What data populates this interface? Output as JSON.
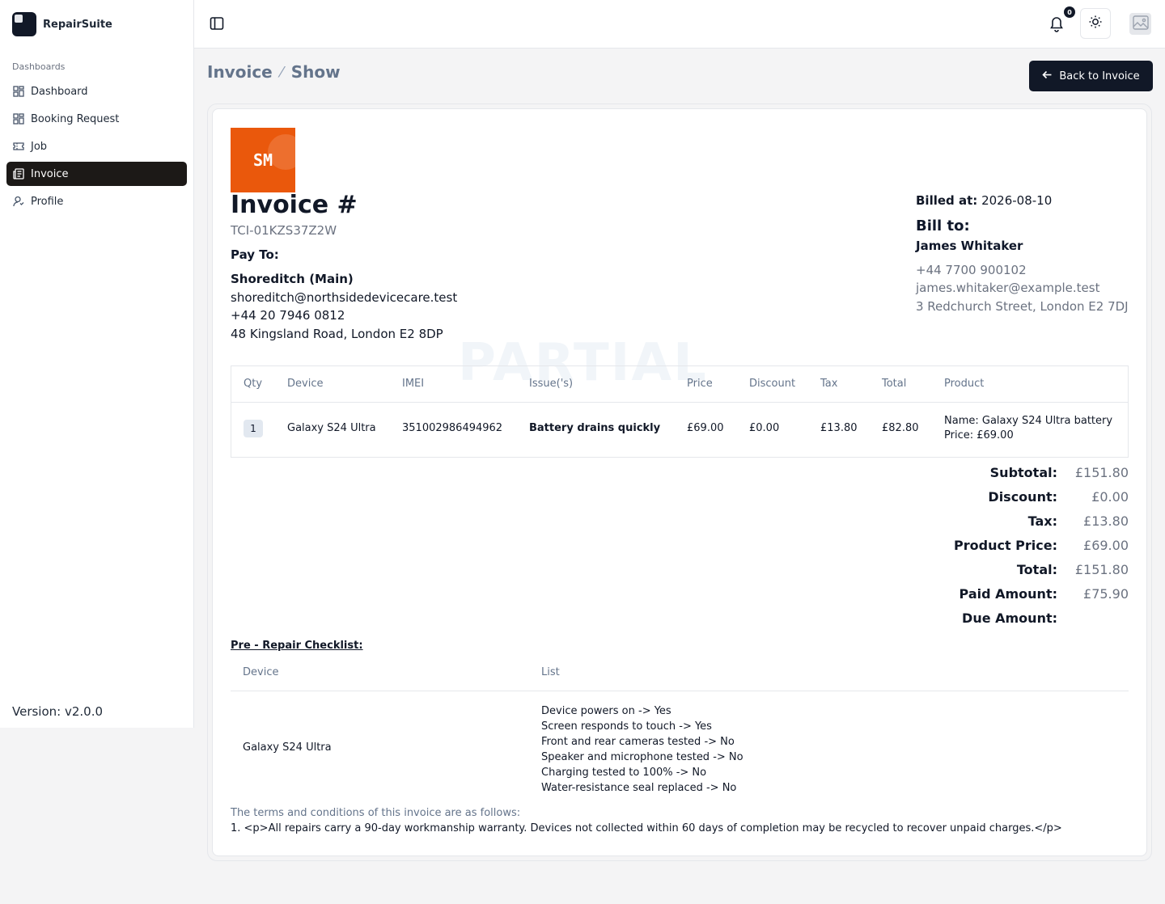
{
  "app": {
    "name": "RepairSuite",
    "version": "Version: v2.0.0"
  },
  "sidebar": {
    "group": "Dashboards",
    "items": [
      {
        "label": "Dashboard",
        "icon": "grid-icon"
      },
      {
        "label": "Booking Request",
        "icon": "grid-icon"
      },
      {
        "label": "Job",
        "icon": "ticket-icon"
      },
      {
        "label": "Invoice",
        "icon": "document-icon",
        "active": true
      },
      {
        "label": "Profile",
        "icon": "user-icon"
      }
    ]
  },
  "topbar": {
    "notification_count": "0"
  },
  "header": {
    "breadcrumb": [
      "Invoice",
      "Show"
    ],
    "back_button": "Back to Invoice"
  },
  "invoice": {
    "logo_text": "SM",
    "title": "Invoice #",
    "number": "TCI-01KZS37Z2W",
    "watermark": "PARTIAL",
    "pay_to_label": "Pay To:",
    "pay_to": {
      "name": "Shoreditch (Main)",
      "email": "shoreditch@northsidedevicecare.test",
      "phone": "+44 20 7946 0812",
      "address": "48 Kingsland Road, London E2 8DP"
    },
    "billed_at_label": "Billed at:",
    "billed_at": "2026-08-10",
    "bill_to_label": "Bill to:",
    "bill_to": {
      "name": "James Whitaker",
      "phone": "+44 7700 900102",
      "email": "james.whitaker@example.test",
      "address": "3 Redchurch Street, London E2 7DJ"
    }
  },
  "items_table": {
    "headers": [
      "Qty",
      "Device",
      "IMEI",
      "Issue('s)",
      "Price",
      "Discount",
      "Tax",
      "Total",
      "Product"
    ],
    "rows": [
      {
        "qty": "1",
        "device": "Galaxy S24 Ultra",
        "imei": "351002986494962",
        "issue": "Battery drains quickly",
        "price": "£69.00",
        "discount": "£0.00",
        "tax": "£13.80",
        "total": "£82.80",
        "product_name": "Name: Galaxy S24 Ultra battery",
        "product_price": "Price: £69.00"
      }
    ]
  },
  "totals": [
    {
      "label": "Subtotal:",
      "value": "£151.80"
    },
    {
      "label": "Discount:",
      "value": "£0.00"
    },
    {
      "label": "Tax:",
      "value": "£13.80"
    },
    {
      "label": "Product Price:",
      "value": "£69.00"
    },
    {
      "label": "Total:",
      "value": "£151.80"
    },
    {
      "label": "Paid Amount:",
      "value": "£75.90"
    },
    {
      "label": "Due Amount:",
      "value": ""
    }
  ],
  "checklist": {
    "title": "Pre - Repair Checklist:",
    "headers": [
      "Device",
      "List"
    ],
    "device": "Galaxy S24 Ultra",
    "items": [
      "Device powers on -> Yes",
      "Screen responds to touch -> Yes",
      "Front and rear cameras tested -> No",
      "Speaker and microphone tested -> No",
      "Charging tested to 100% -> No",
      "Water-resistance seal replaced -> No"
    ]
  },
  "terms": {
    "title": "The terms and conditions of this invoice are as follows:",
    "text": "1. <p>All repairs carry a 90-day workmanship warranty. Devices not collected within 60 days of completion may be recycled to recover unpaid charges.</p>"
  }
}
